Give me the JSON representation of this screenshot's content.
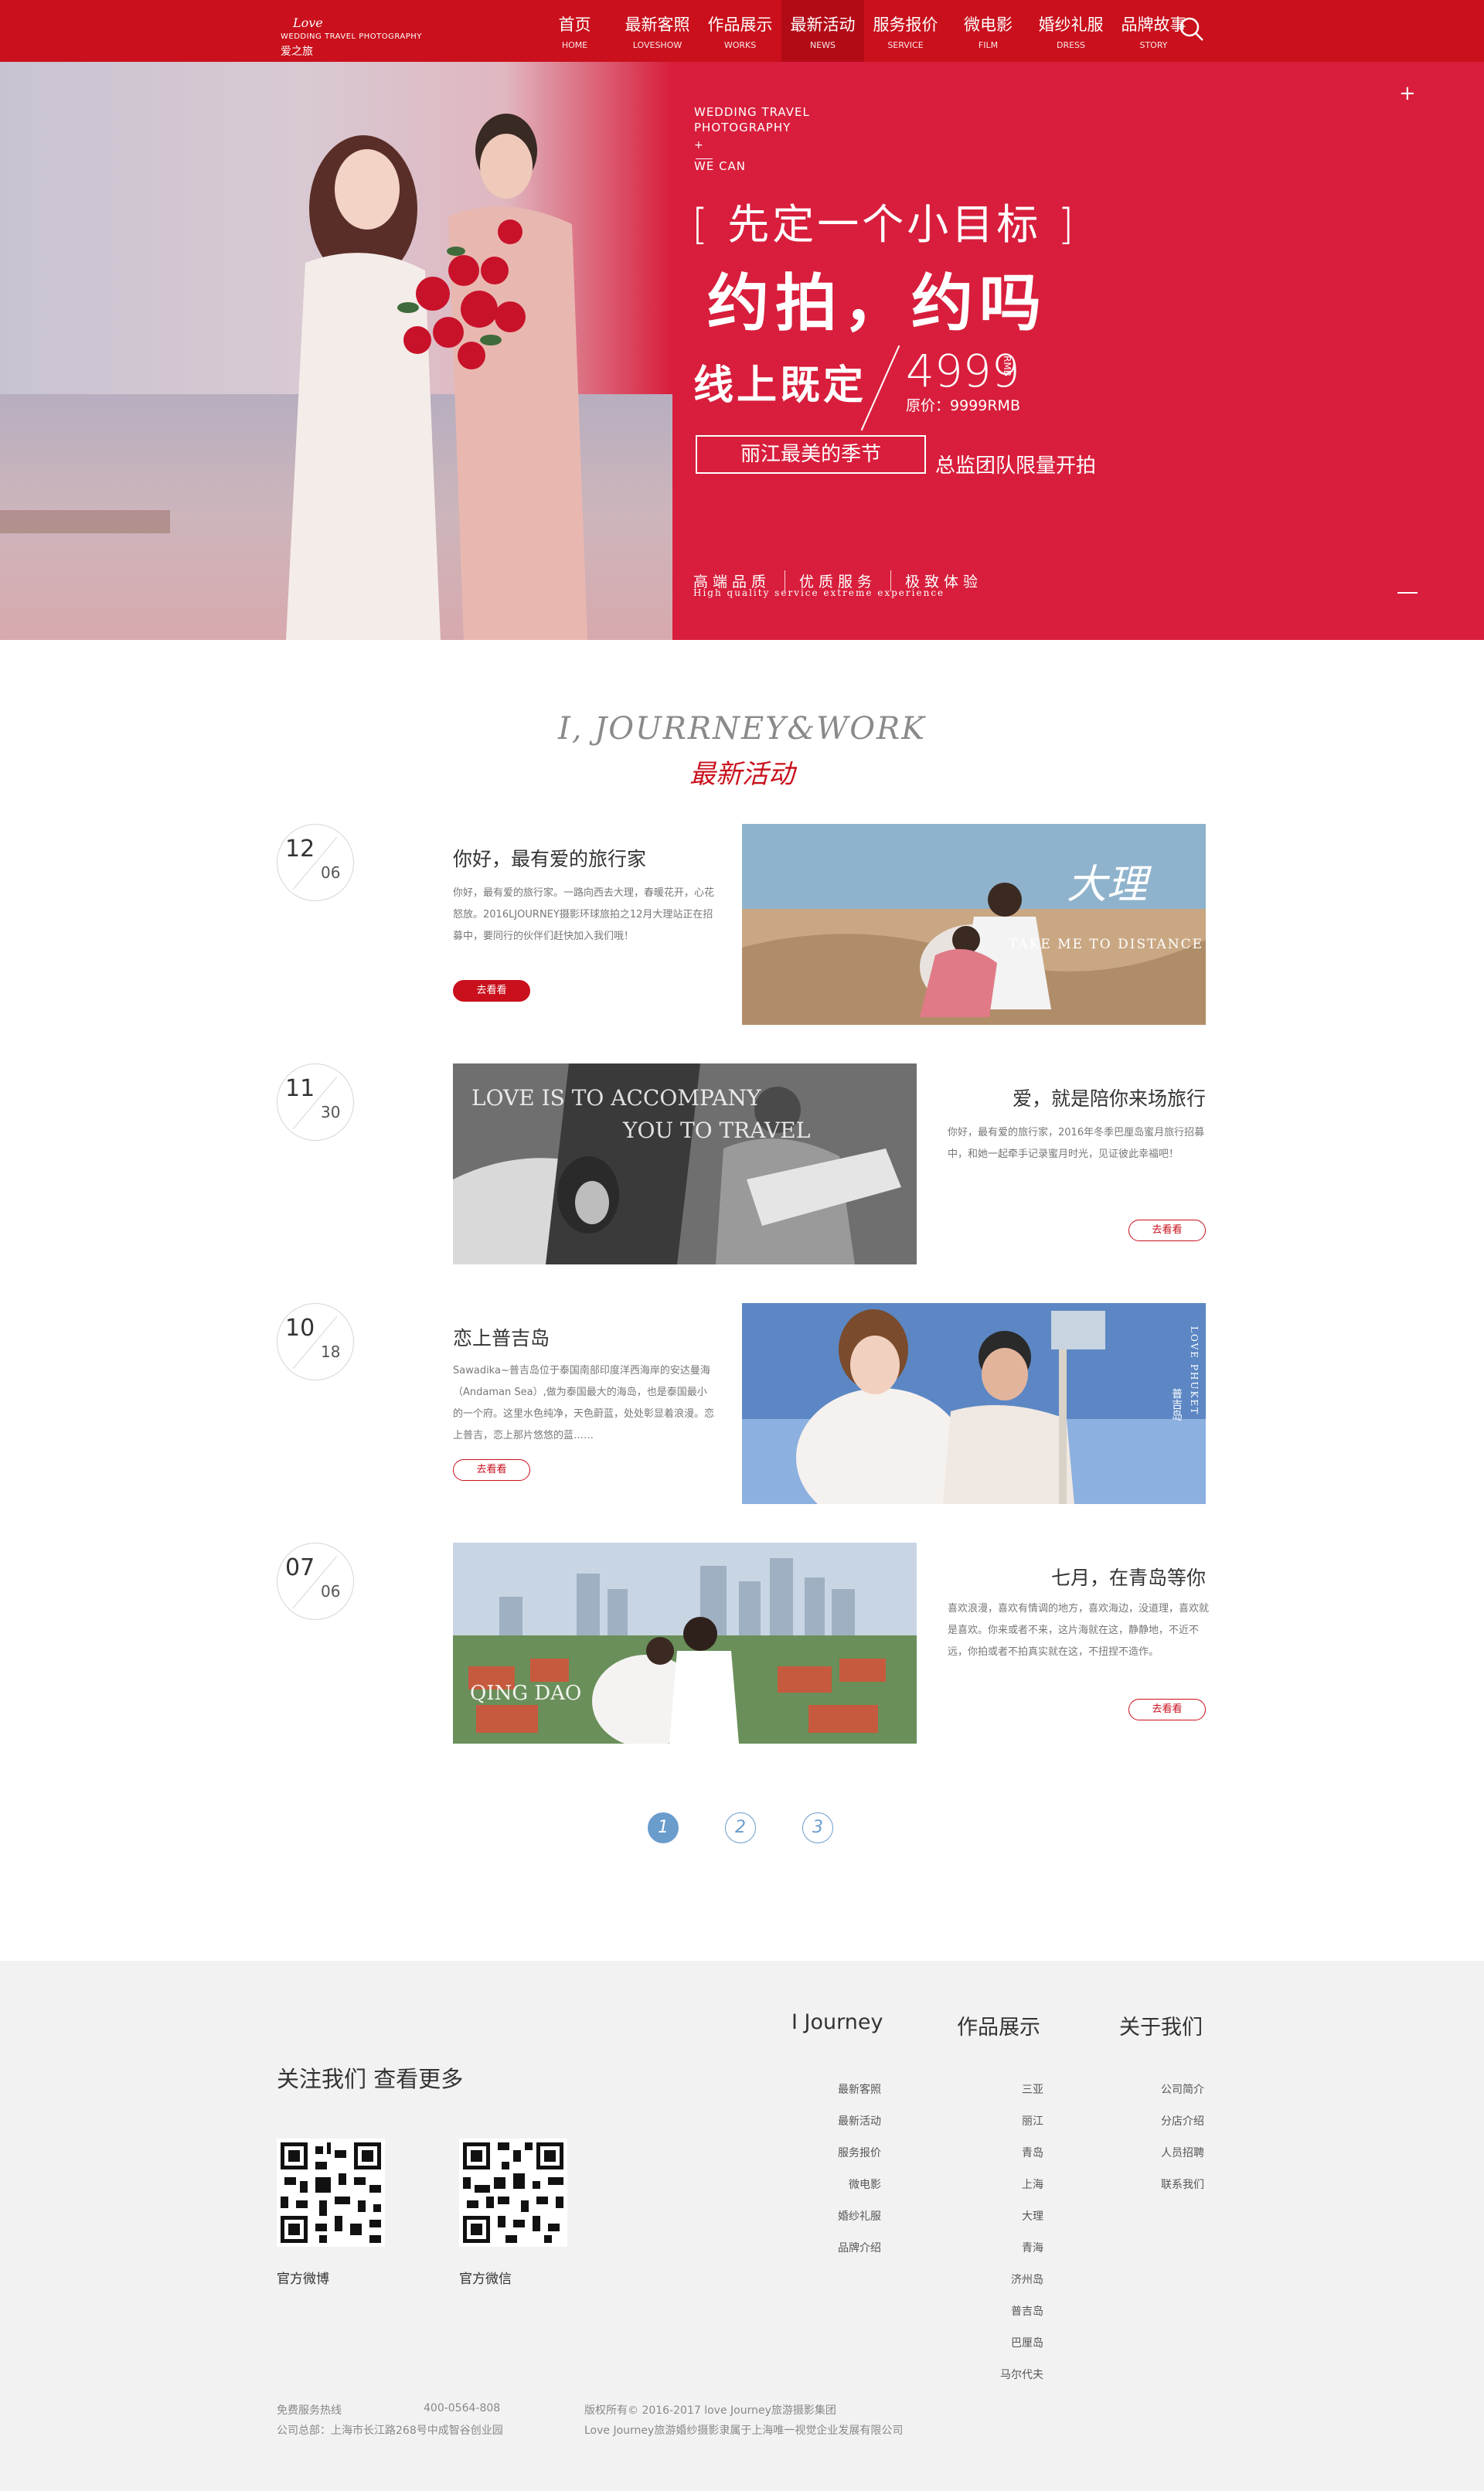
{
  "brand": {
    "logo_mark": "Love",
    "logo_sub": "WEDDING TRAVEL PHOTOGRAPHY",
    "logo_cn": "爱之旅"
  },
  "nav": {
    "items": [
      {
        "cn": "首页",
        "en": "HOME"
      },
      {
        "cn": "最新客照",
        "en": "LOVESHOW"
      },
      {
        "cn": "作品展示",
        "en": "WORKS"
      },
      {
        "cn": "最新活动",
        "en": "NEWS"
      },
      {
        "cn": "服务报价",
        "en": "SERVICE"
      },
      {
        "cn": "微电影",
        "en": "FILM"
      },
      {
        "cn": "婚纱礼服",
        "en": "DRESS"
      },
      {
        "cn": "品牌故事",
        "en": "STORY"
      }
    ],
    "active_index": 3,
    "search_icon": "search-icon"
  },
  "banner": {
    "line1": "WEDDING TRAVEL",
    "line2": "PHOTOGRAPHY",
    "plus": "+",
    "line3": "WE CAN",
    "slogan": "[ 先定一个小目标 ]",
    "headline": "约拍，约吗",
    "offer": "线上既定",
    "price": "4999",
    "price_unit": "RMB",
    "original_price": "原价：9999RMB",
    "tag": "丽江最美的季节",
    "note": "总监团队限量开拍",
    "features": [
      "高端品质",
      "优质服务",
      "极致体验"
    ],
    "features_en": "High quality  service  extreme experience",
    "corner_plus": "+"
  },
  "section": {
    "title_en": "I,  JOURRNEY&WORK",
    "title_cn": "最新活动"
  },
  "news": [
    {
      "month": "12",
      "day": "06",
      "title": "你好，最有爱的旅行家",
      "desc": "你好，最有爱的旅行家。一路向西去大理，春暖花开，心花怒放。2016LJOURNEY摄影环球旅拍之12月大理站正在招募中，要同行的伙伴们赶快加入我们哦！",
      "button": "去看看",
      "caption_big": "大理",
      "caption_small": "TAKE ME TO DISTANCE"
    },
    {
      "month": "11",
      "day": "30",
      "title": "爱，就是陪你来场旅行",
      "desc": "你好，最有爱的旅行家，2016年冬季巴厘岛蜜月旅行招募中，和她一起牵手记录蜜月时光，见证彼此幸福吧！",
      "button": "去看看",
      "caption_big": "LOVE IS TO ACCOMPANY",
      "caption_small": "YOU TO TRAVEL"
    },
    {
      "month": "10",
      "day": "18",
      "title": "恋上普吉岛",
      "desc": "Sawadika~普吉岛位于泰国南部印度洋西海岸的安达曼海（Andaman Sea）,做为泰国最大的海岛，也是泰国最小的一个府。这里水色纯净，天色蔚蓝，处处彰显着浪漫。恋上普吉，恋上那片悠悠的蓝……",
      "button": "去看看",
      "caption_big": "普吉岛",
      "caption_small": "LOVE PHUKET"
    },
    {
      "month": "07",
      "day": "06",
      "title": "七月，在青岛等你",
      "desc": "喜欢浪漫，喜欢有情调的地方，喜欢海边，没道理，喜欢就是喜欢。你来或者不来，这片海就在这，静静地，不近不远，你拍或者不拍真实就在这，不扭捏不造作。",
      "button": "去看看",
      "caption_big": "QING DAO",
      "caption_small": ""
    }
  ],
  "pagination": [
    "1",
    "2",
    "3"
  ],
  "footer": {
    "follow": "关注我们 查看更多",
    "qr_weibo": "官方微博",
    "qr_wechat": "官方微信",
    "col1": {
      "title": "I Journey",
      "links": [
        "最新客照",
        "最新活动",
        "服务报价",
        "微电影",
        "婚纱礼服",
        "品牌介绍"
      ]
    },
    "col2": {
      "title": "作品展示",
      "links": [
        "三亚",
        "丽江",
        "青岛",
        "上海",
        "大理",
        "青海",
        "济州岛",
        "普吉岛",
        "巴厘岛",
        "马尔代夫"
      ]
    },
    "col3": {
      "title": "关于我们",
      "links": [
        "公司简介",
        "分店介绍",
        "人员招聘",
        "联系我们"
      ]
    },
    "hotline_label": "免费服务热线",
    "hotline": "400-0564-808",
    "address": "公司总部：上海市长江路268号中成智谷创业园",
    "copyright": "版权所有© 2016-2017 love Journey旅游摄影集团",
    "copyright2": "Love Journey旅游婚纱摄影隶属于上海唯一视觉企业发展有限公司"
  },
  "colors": {
    "brand_red": "#c9101c",
    "banner_red": "#d81e3c",
    "pager_blue": "#6a9ccc",
    "footer_bg": "#f2f2f2"
  }
}
